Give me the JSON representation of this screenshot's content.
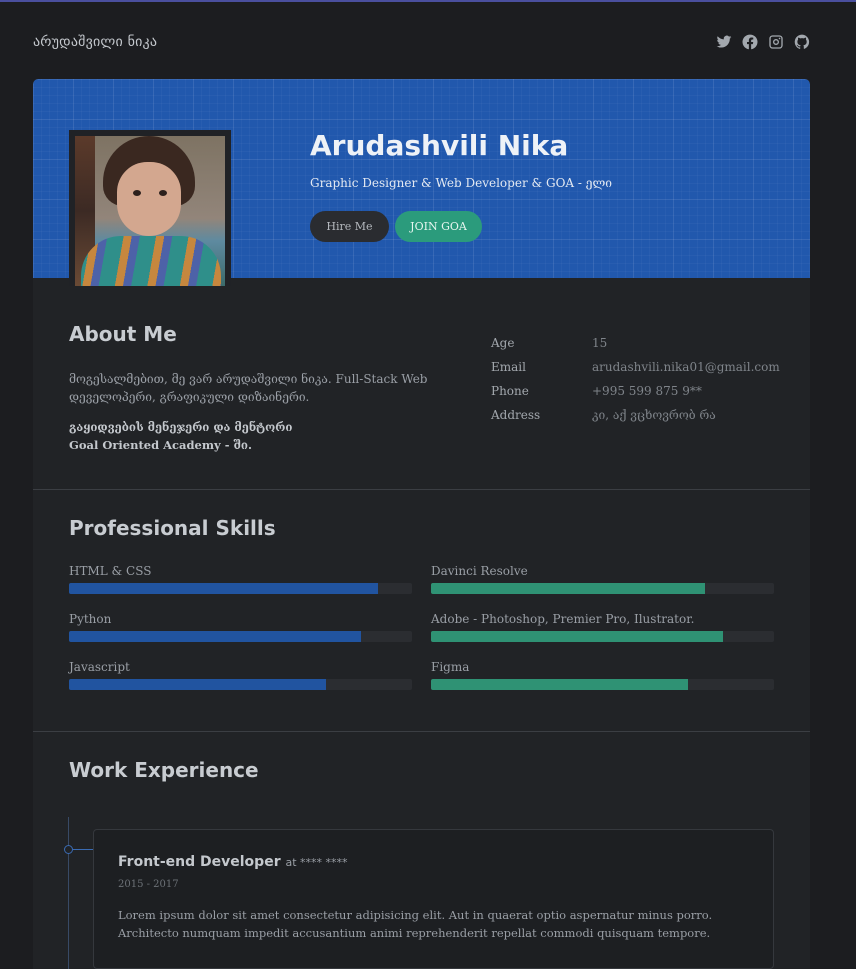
{
  "header": {
    "brand": "არუდაშვილი ნიკა",
    "socials": [
      {
        "name": "twitter",
        "icon": "twitter-icon"
      },
      {
        "name": "facebook",
        "icon": "facebook-icon"
      },
      {
        "name": "instagram",
        "icon": "instagram-icon"
      },
      {
        "name": "github",
        "icon": "github-icon"
      }
    ]
  },
  "hero": {
    "name": "Arudashvili Nika",
    "title": "Graphic Designer & Web Developer & GOA - ელი",
    "hire_label": "Hire Me",
    "join_label": "JOIN GOA",
    "accent": "#2158ad",
    "join_color": "#2b9b7c"
  },
  "about": {
    "title": "About Me",
    "paragraph": "მოგესალმებით, მე ვარ არუდაშვილი ნიკა. Full-Stack Web დეველოპერი, გრაფიკული დიზაინერი.",
    "bold_line1": "გაყიდვების მენეჯერი და მენტორი",
    "bold_line2": "Goal Oriented Academy - ში.",
    "info": [
      {
        "key": "Age",
        "value": "15"
      },
      {
        "key": "Email",
        "value": "arudashvili.nika01@gmail.com"
      },
      {
        "key": "Phone",
        "value": "+995 599 875 9**"
      },
      {
        "key": "Address",
        "value": "კი, აქ ვცხოვრობ რა"
      }
    ]
  },
  "skills": {
    "title": "Professional Skills",
    "left": [
      {
        "label": "HTML & CSS",
        "level": 90
      },
      {
        "label": "Python",
        "level": 85
      },
      {
        "label": "Javascript",
        "level": 75
      }
    ],
    "right": [
      {
        "label": "Davinci Resolve",
        "level": 80
      },
      {
        "label": "Adobe - Photoshop, Premier Pro, Ilustrator.",
        "level": 85
      },
      {
        "label": "Figma",
        "level": 75
      }
    ]
  },
  "work": {
    "title": "Work Experience",
    "jobs": [
      {
        "role": "Front-end Developer",
        "at": "at **** ****",
        "dates": "2015 - 2017",
        "description": "Lorem ipsum dolor sit amet consectetur adipisicing elit. Aut in quaerat optio aspernatur minus porro. Architecto numquam impedit accusantium animi reprehenderit repellat commodi quisquam tempore."
      }
    ]
  }
}
